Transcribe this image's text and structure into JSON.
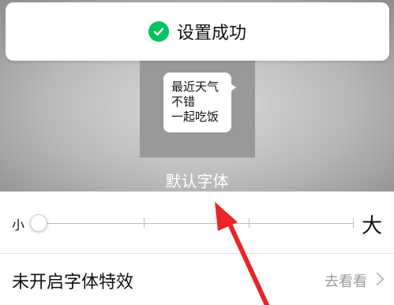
{
  "toast": {
    "text": "设置成功"
  },
  "preview": {
    "bubble_lines": [
      "最近天气",
      "不错",
      "一起吃饭"
    ],
    "font_name": "默认字体"
  },
  "font_size_slider": {
    "small_label": "小",
    "large_label": "大",
    "tick_count": 5,
    "selected_level_fraction": 0
  },
  "effect_row": {
    "label": "未开启字体特效",
    "link": "去看看"
  },
  "colors": {
    "success": "#07c160",
    "annotation_arrow": "#e8262a"
  }
}
